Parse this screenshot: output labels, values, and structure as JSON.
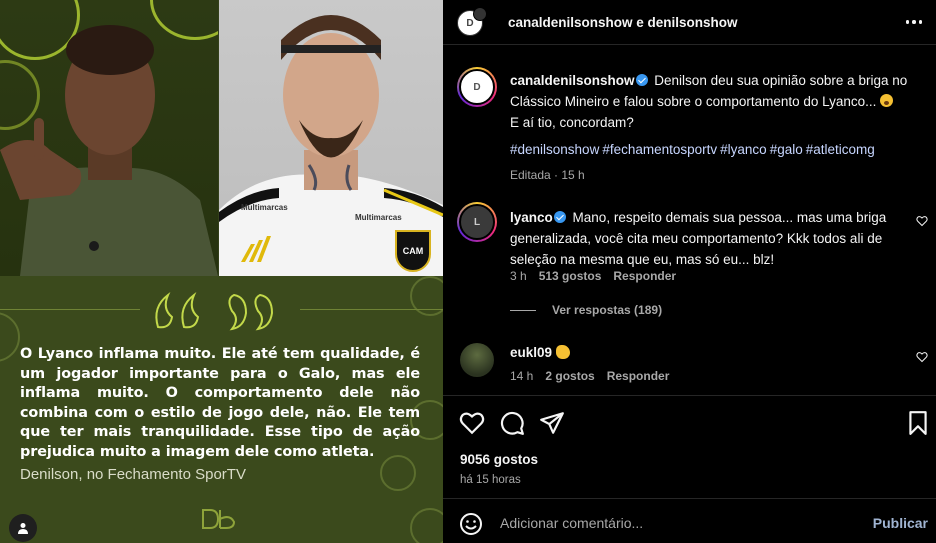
{
  "post_image": {
    "quote": "O Lyanco inflama muito. Ele até tem qualidade, é um jogador importante para o Galo, mas ele inflama muito. O comportamento dele não combina com o estilo de jogo dele, não. Ele tem que ter mais tranquilidade. Esse tipo de ação prejudica muito a imagem dele como atleta.",
    "author": "Denilson, no Fechamento SporTV",
    "shirt_sponsor_1": "Multimarcas",
    "shirt_sponsor_2": "Multimarcas",
    "shirt_sponsor_3": "Multimarcas",
    "crest_text": "CAM",
    "user_tag_icon": "user-icon"
  },
  "header": {
    "title": "canaldenilsonshow e denilsonshow",
    "more_icon": "more-horizontal-icon"
  },
  "caption": {
    "username": "canaldenilsonshow",
    "text": "Denilson deu sua opinião sobre a briga no Clássico Mineiro e falou sobre o comportamento do Lyanco...",
    "text2": "E aí tio, concordam?",
    "hashtags": [
      "#denilsonshow",
      "#fechamentosportv",
      "#lyanco",
      "#galo",
      "#atleticomg"
    ],
    "meta_edited": "Editada",
    "meta_time": "15 h"
  },
  "comments": [
    {
      "username": "lyanco",
      "text": "Mano, respeito demais sua pessoa... mas uma briga generalizada, você cita meu comportamento? Kkk todos ali de seleção na mesma que eu, mas só eu... blz!",
      "time": "3 h",
      "likes": "513 gostos",
      "reply": "Responder",
      "view_replies": "Ver respostas (189)"
    },
    {
      "username": "eukl09",
      "time": "14 h",
      "likes": "2 gostos",
      "reply": "Responder"
    }
  ],
  "actions": {
    "likes_count": "9056 gostos",
    "posted_time": "há 15 horas",
    "comment_placeholder": "Adicionar comentário...",
    "publish_label": "Publicar"
  },
  "colors": {
    "accent_green": "#b8d435",
    "quote_bg": "#3b4a1c",
    "link_blue": "#c7d6ff",
    "verified_blue": "#3897f0"
  }
}
